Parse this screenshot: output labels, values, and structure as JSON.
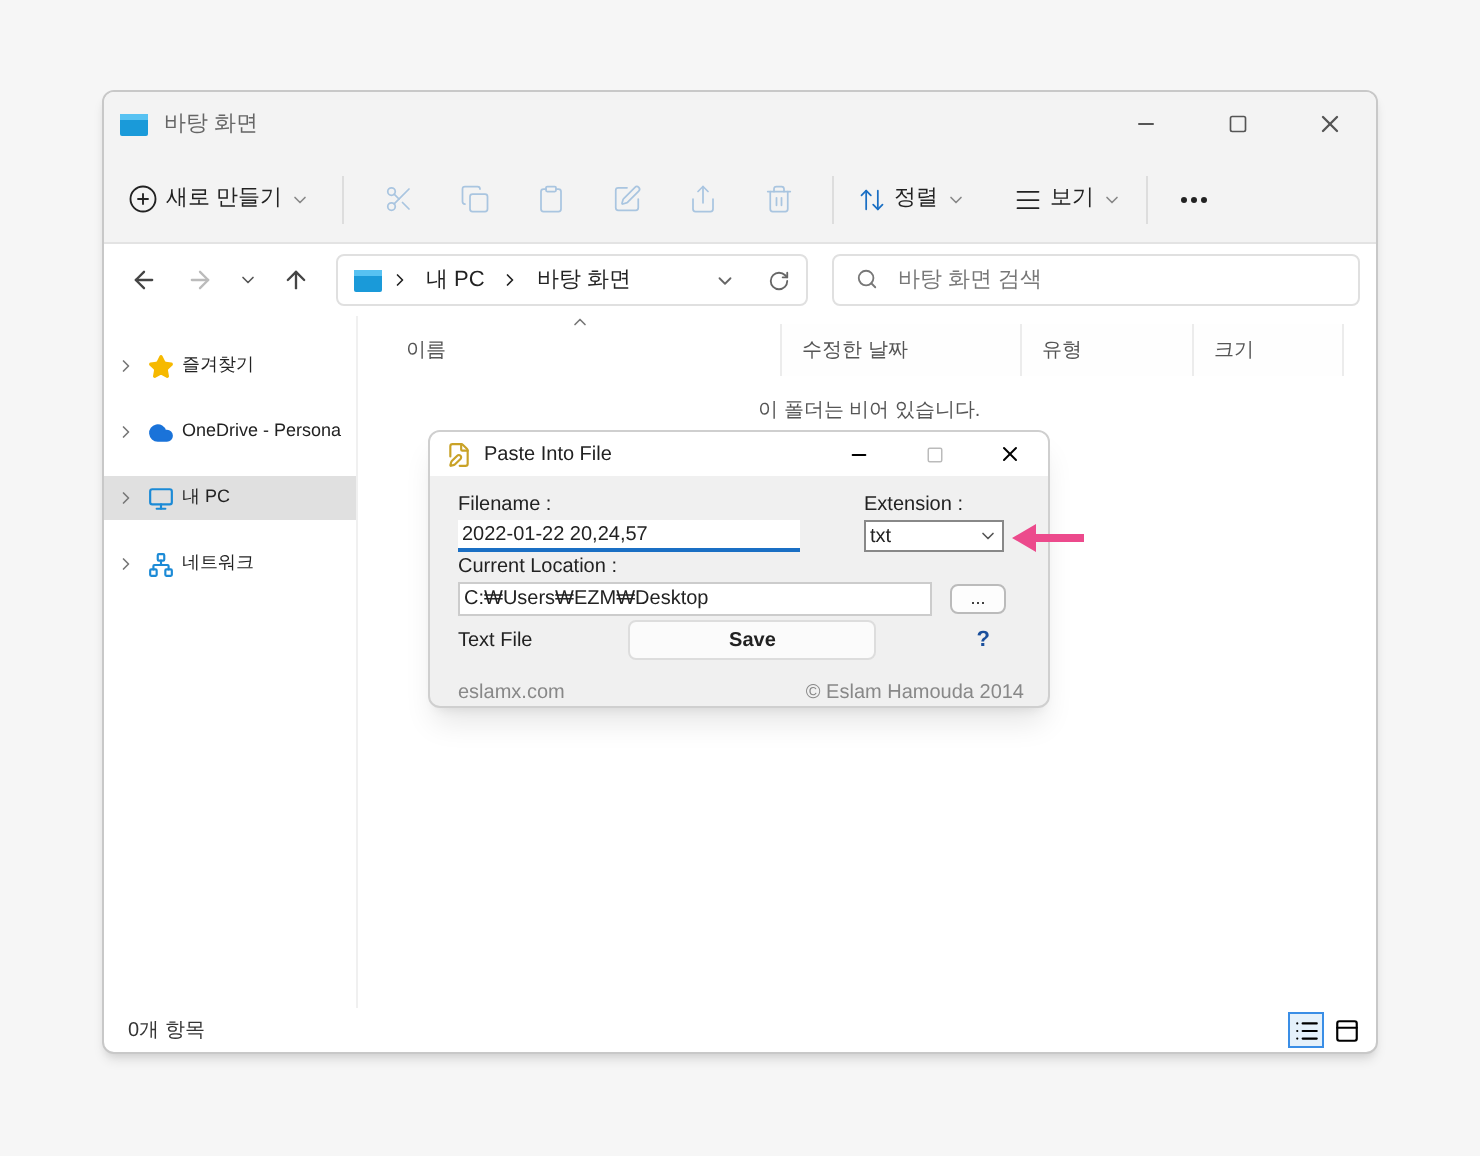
{
  "window": {
    "title": "바탕 화면"
  },
  "toolbar": {
    "new_button": "새로 만들기",
    "actions": [
      {
        "kind": "cut",
        "disabled": true
      },
      {
        "kind": "copy",
        "disabled": true
      },
      {
        "kind": "paste",
        "disabled": true
      },
      {
        "kind": "rename",
        "disabled": true
      },
      {
        "kind": "share",
        "disabled": true
      },
      {
        "kind": "delete",
        "disabled": true
      }
    ],
    "sort_button": "정렬",
    "view_button": "보기"
  },
  "navigation": {
    "back_disabled": false,
    "forward_disabled": true
  },
  "address": {
    "crumbs": [
      "내 PC",
      "바탕 화면"
    ]
  },
  "search": {
    "placeholder": "바탕 화면 검색"
  },
  "sidebar": {
    "items": [
      {
        "kind": "star",
        "label": "즐겨찾기",
        "selected": false
      },
      {
        "kind": "cloud",
        "label": "OneDrive - Persona",
        "selected": false
      },
      {
        "kind": "pc",
        "label": "내 PC",
        "selected": true
      },
      {
        "kind": "network",
        "label": "네트워크",
        "selected": false
      }
    ]
  },
  "table": {
    "columns": [
      {
        "label": "이름",
        "sorted": true
      },
      {
        "label": "수정한 날짜",
        "sorted": false
      },
      {
        "label": "유형",
        "sorted": false
      },
      {
        "label": "크기",
        "sorted": false
      }
    ],
    "empty_message": "이 폴더는 비어 있습니다."
  },
  "status_bar": {
    "count": "0개 항목",
    "views": [
      {
        "kind": "details",
        "selected": true
      },
      {
        "kind": "tiles",
        "selected": false
      }
    ]
  },
  "dialog": {
    "title": "Paste Into File",
    "filename_label": "Filename :",
    "filename_value": "2022-01-22 20,24,57",
    "extension_label": "Extension :",
    "extension_value": "txt",
    "location_label": "Current Location :",
    "location_value": "C:₩Users₩EZM₩Desktop",
    "browse_button": "...",
    "type_label": "Text File",
    "save_button": "Save",
    "help": "?",
    "footer_left": "eslamx.com",
    "footer_right": "© Eslam Hamouda 2014"
  }
}
